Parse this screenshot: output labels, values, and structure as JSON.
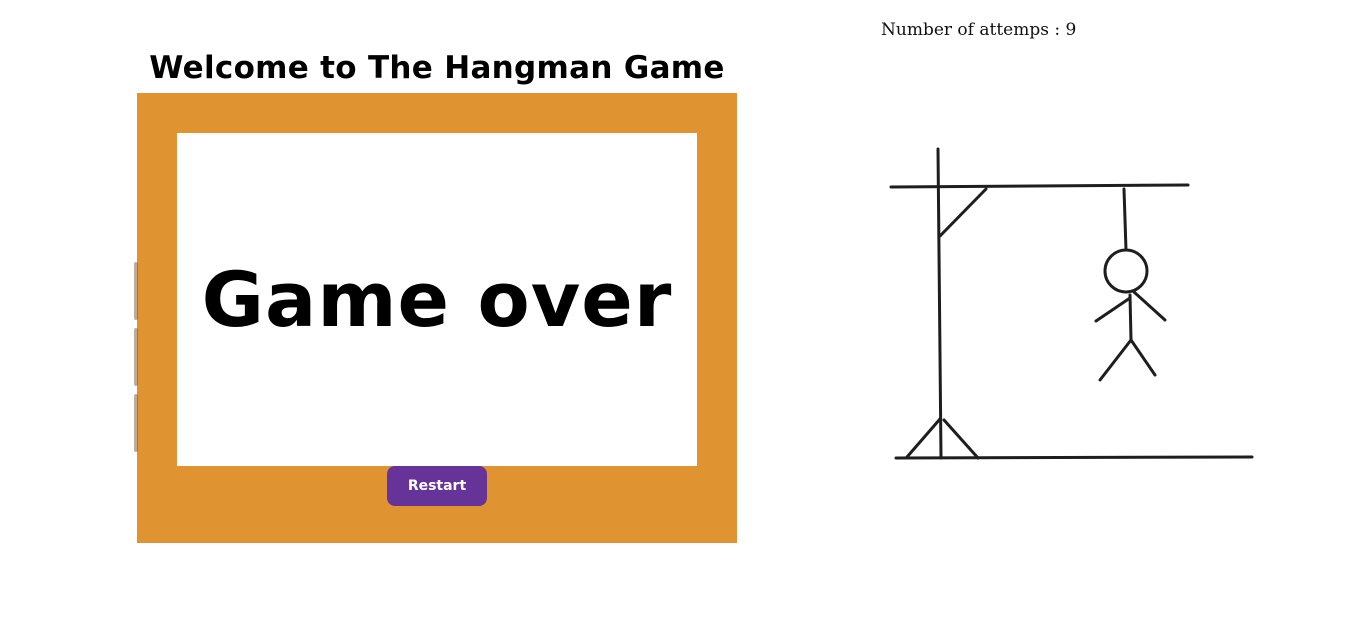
{
  "header": {
    "title": "Welcome to The Hangman Game"
  },
  "game": {
    "overlay_message": "Game over",
    "restart_label": "Restart"
  },
  "status": {
    "attempts_label": "Number of attemps",
    "attempts_separator": " : ",
    "attempts_count": "9"
  },
  "colors": {
    "board": "#e09431",
    "overlay": "#ffffff",
    "restart_button": "#663399",
    "drawing_stroke": "#1e1e1e"
  },
  "icons": {
    "hangman_drawing": "hangman-figure-icon"
  }
}
